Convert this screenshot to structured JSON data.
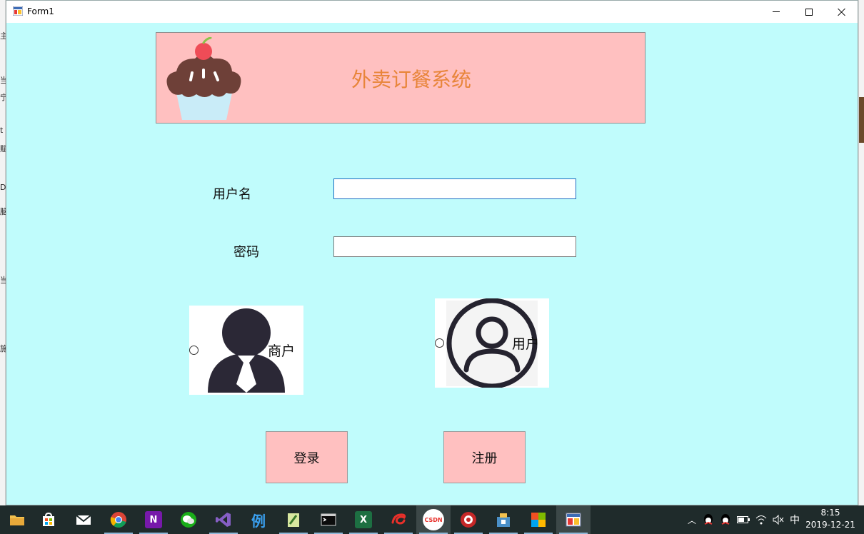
{
  "window": {
    "title": "Form1"
  },
  "banner": {
    "heading": "外卖订餐系统"
  },
  "form": {
    "username_label": "用户名",
    "password_label": "密码",
    "username_value": "",
    "password_value": ""
  },
  "roles": {
    "merchant_label": "商户",
    "customer_label": "用户"
  },
  "buttons": {
    "login": "登录",
    "register": "注册"
  },
  "taskbar": {
    "items": [
      "file-explorer",
      "store",
      "mail",
      "chrome",
      "onenote",
      "wechat",
      "visual-studio",
      "example-app",
      "notepad-plus",
      "terminal",
      "excel",
      "app-red",
      "csdn",
      "app-record",
      "app-tools",
      "app-collage",
      "form1-app"
    ],
    "csdn_text": "CSDN",
    "example_text": "例",
    "ime": "中",
    "time": "8:15",
    "date": "2019-12-21"
  },
  "colors": {
    "client_bg": "#c0fcfc",
    "banner_bg": "#ffc0c0",
    "heading": "#e8853a",
    "button_bg": "#ffc0c0"
  }
}
